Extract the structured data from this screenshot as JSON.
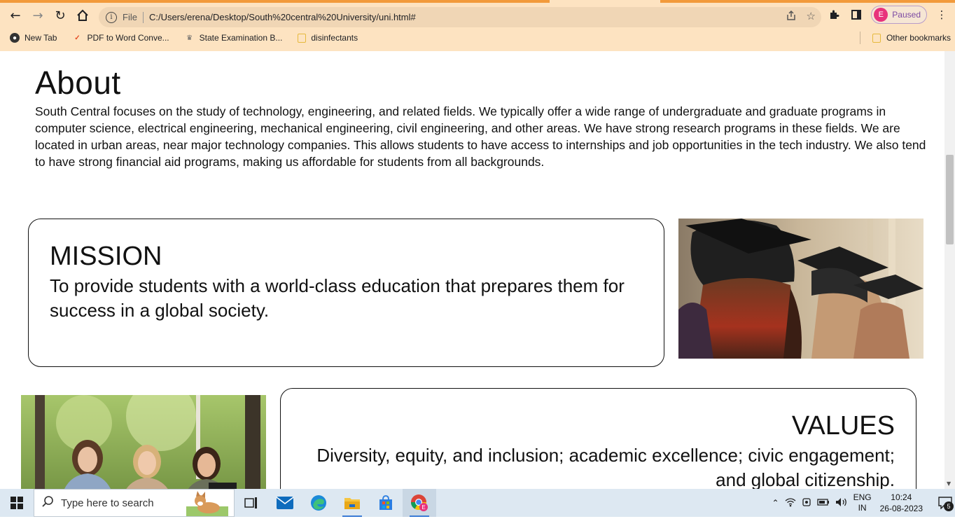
{
  "browser": {
    "address": {
      "scheme_label": "File",
      "url": "C:/Users/erena/Desktop/South%20central%20University/uni.html#"
    },
    "profile": {
      "initial": "E",
      "status": "Paused"
    },
    "bookmarks": [
      {
        "label": "New Tab",
        "icon": "globe-icon"
      },
      {
        "label": "PDF to Word Conve...",
        "icon": "pdf-icon"
      },
      {
        "label": "State Examination B...",
        "icon": "emblem-icon"
      },
      {
        "label": "disinfectants",
        "icon": "folder-icon"
      }
    ],
    "other_bookmarks": "Other bookmarks",
    "accent_color": "#f29a3b",
    "chrome_color": "#fde3c1"
  },
  "page": {
    "about": {
      "title": "About",
      "text": "South Central focuses on the study of technology, engineering, and related fields. We typically offer a wide range of undergraduate and graduate programs in computer science, electrical engineering, mechanical engineering, civil engineering, and other areas. We have strong research programs in these fields. We are located in urban areas, near major technology companies. This allows students to have access to internships and job opportunities in the tech industry. We also tend to have strong financial aid programs, making us affordable for students from all backgrounds."
    },
    "mission": {
      "title": "MISSION",
      "text": "To provide students with a world-class education that prepares them for success in a global society."
    },
    "values": {
      "title": "VALUES",
      "text": "Diversity, equity, and inclusion; academic excellence; civic engagement; and global citizenship."
    }
  },
  "taskbar": {
    "search_placeholder": "Type here to search",
    "lang_top": "ENG",
    "lang_bottom": "IN",
    "time": "10:24",
    "date": "26-08-2023",
    "notification_count": "5"
  }
}
